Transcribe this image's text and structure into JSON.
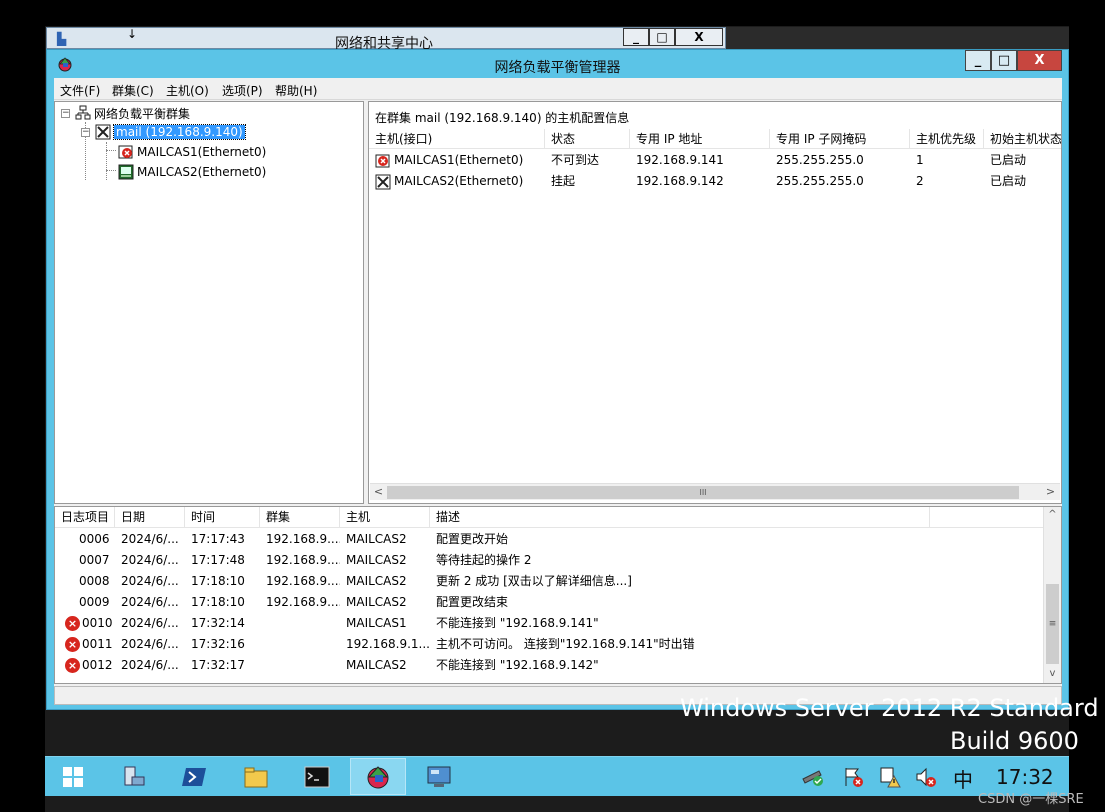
{
  "bg_window": {
    "title": "网络和共享中心",
    "min": "_",
    "max": "□",
    "close": "X"
  },
  "window": {
    "title": "网络负载平衡管理器",
    "min": "_",
    "max": "□",
    "close": "X"
  },
  "menu": {
    "file": "文件(F)",
    "cluster": "群集(C)",
    "host": "主机(O)",
    "options": "选项(P)",
    "help": "帮助(H)"
  },
  "tree": {
    "root": "网络负载平衡群集",
    "cluster": "mail (192.168.9.140)",
    "hosts": [
      "MAILCAS1(Ethernet0)",
      "MAILCAS2(Ethernet0)"
    ]
  },
  "details": {
    "header": "在群集 mail (192.168.9.140) 的主机配置信息",
    "columns": [
      "主机(接口)",
      "状态",
      "专用 IP 地址",
      "专用 IP 子网掩码",
      "主机优先级",
      "初始主机状态"
    ],
    "rows": [
      {
        "host": "MAILCAS1(Ethernet0)",
        "status": "不可到达",
        "ip": "192.168.9.141",
        "mask": "255.255.255.0",
        "priority": "1",
        "initial": "已启动"
      },
      {
        "host": "MAILCAS2(Ethernet0)",
        "status": "挂起",
        "ip": "192.168.9.142",
        "mask": "255.255.255.0",
        "priority": "2",
        "initial": "已启动"
      }
    ],
    "scroll_thumb": "III"
  },
  "log": {
    "columns": [
      "日志项目",
      "日期",
      "时间",
      "群集",
      "主机",
      "描述"
    ],
    "rows": [
      {
        "id": "0006",
        "date": "2024/6/...",
        "time": "17:17:43",
        "cluster": "192.168.9....",
        "host": "MAILCAS2",
        "desc": "配置更改开始",
        "error": false
      },
      {
        "id": "0007",
        "date": "2024/6/...",
        "time": "17:17:48",
        "cluster": "192.168.9....",
        "host": "MAILCAS2",
        "desc": "等待挂起的操作 2",
        "error": false
      },
      {
        "id": "0008",
        "date": "2024/6/...",
        "time": "17:18:10",
        "cluster": "192.168.9....",
        "host": "MAILCAS2",
        "desc": "更新 2 成功 [双击以了解详细信息...]",
        "error": false
      },
      {
        "id": "0009",
        "date": "2024/6/...",
        "time": "17:18:10",
        "cluster": "192.168.9....",
        "host": "MAILCAS2",
        "desc": "配置更改结束",
        "error": false
      },
      {
        "id": "0010",
        "date": "2024/6/...",
        "time": "17:32:14",
        "cluster": "",
        "host": "MAILCAS1",
        "desc": "不能连接到 \"192.168.9.141\"",
        "error": true
      },
      {
        "id": "0011",
        "date": "2024/6/...",
        "time": "17:32:16",
        "cluster": "",
        "host": "192.168.9.1...",
        "desc": "主机不可访问。 连接到\"192.168.9.141\"时出错",
        "error": true
      },
      {
        "id": "0012",
        "date": "2024/6/...",
        "time": "17:32:17",
        "cluster": "",
        "host": "MAILCAS2",
        "desc": "不能连接到 \"192.168.9.142\"",
        "error": true
      }
    ],
    "scroll_thumb": "≡"
  },
  "desktop": {
    "watermark_line1": "Windows Server 2012 R2 Standard",
    "watermark_line2": "Build 9600"
  },
  "taskbar": {
    "ime": "中",
    "clock": "17:32"
  },
  "credit": "CSDN @一棵SRE",
  "colors": {
    "title_bar": "#5bc4e7",
    "selection": "#3399ff",
    "error": "#d7261e",
    "close_button": "#c7463f"
  }
}
